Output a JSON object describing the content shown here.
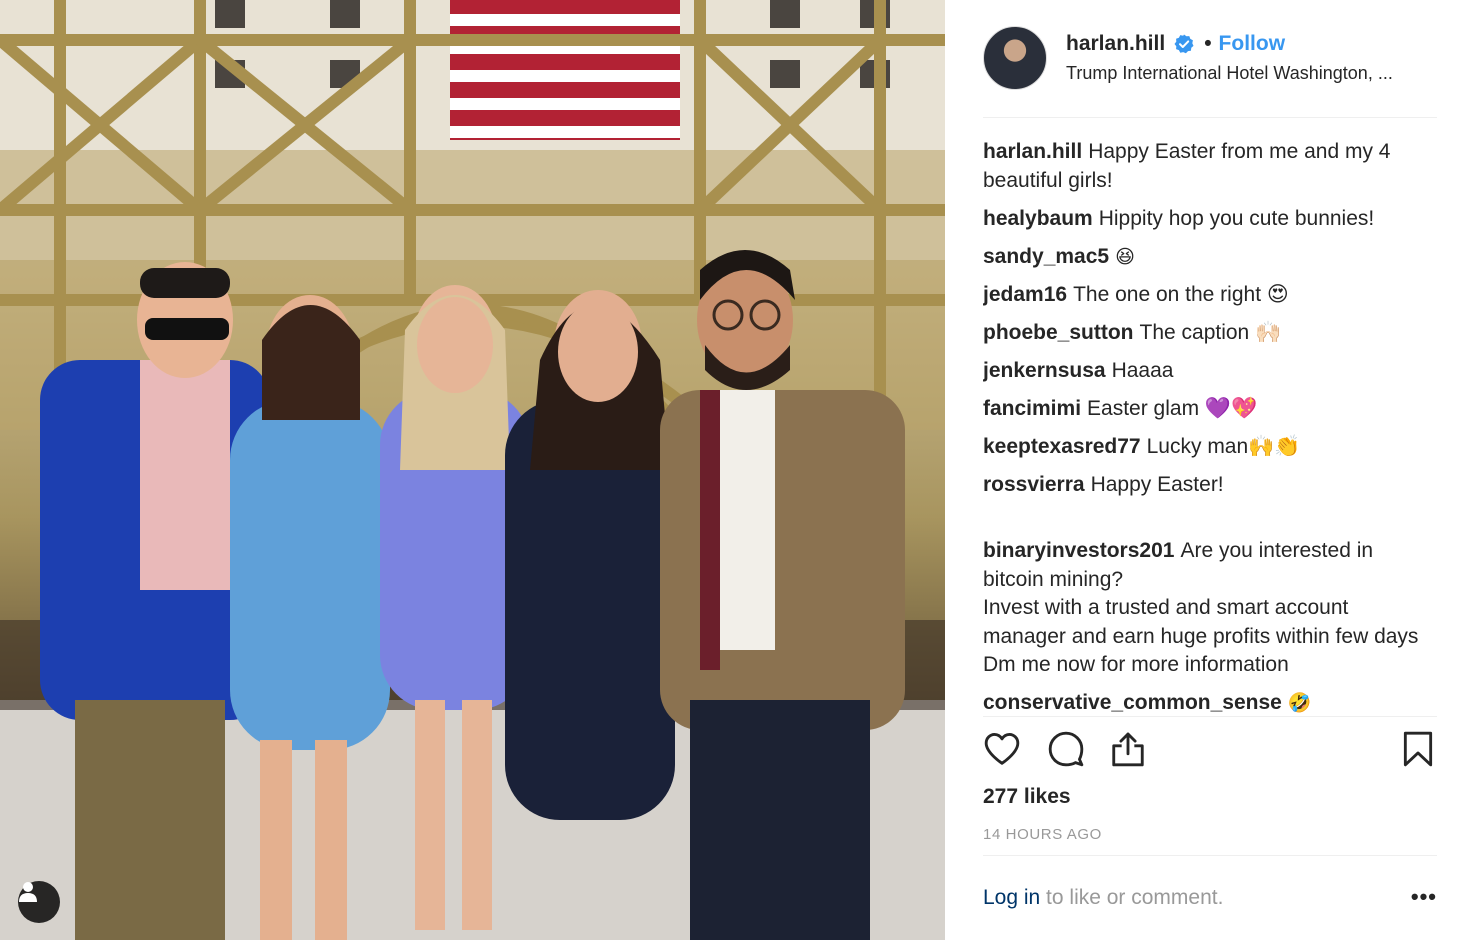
{
  "post": {
    "username": "harlan.hill",
    "follow_label": "Follow",
    "location": "Trump International Hotel Washington, ..."
  },
  "comments": [
    {
      "user": "harlan.hill",
      "text": "Happy Easter from me and my 4 beautiful girls!"
    },
    {
      "user": "healybaum",
      "text": "Hippity hop you cute bunnies!"
    },
    {
      "user": "sandy_mac5",
      "text": "😆"
    },
    {
      "user": "jedam16",
      "text": "The one on the right 😍"
    },
    {
      "user": "phoebe_sutton",
      "text": "The caption 🙌🏻"
    },
    {
      "user": "jenkernsusa",
      "text": "Haaaa"
    },
    {
      "user": "fancimimi",
      "text": "Easter glam 💜💖"
    },
    {
      "user": "keeptexasred77",
      "text": "Lucky man🙌👏"
    },
    {
      "user": "rossvierra",
      "text": "Happy Easter!"
    },
    {
      "user": "binaryinvestors201",
      "text": "Are you interested in bitcoin mining?\nInvest with a trusted and smart account manager and earn huge profits within few days\nDm me now for more information"
    },
    {
      "user": "conservative_common_sense",
      "text": "🤣"
    }
  ],
  "likes": "277 likes",
  "timestamp": "14 HOURS AGO",
  "footer": {
    "login": "Log in",
    "rest": " to like or comment.",
    "more": "•••"
  },
  "icons": {
    "verified": "verified-badge-icon",
    "like": "heart-icon",
    "comment": "comment-icon",
    "share": "share-icon",
    "save": "bookmark-icon",
    "user_tag": "user-icon"
  },
  "colors": {
    "link_blue": "#3897f0",
    "login_blue": "#003569",
    "muted": "#999999",
    "text": "#262626"
  }
}
